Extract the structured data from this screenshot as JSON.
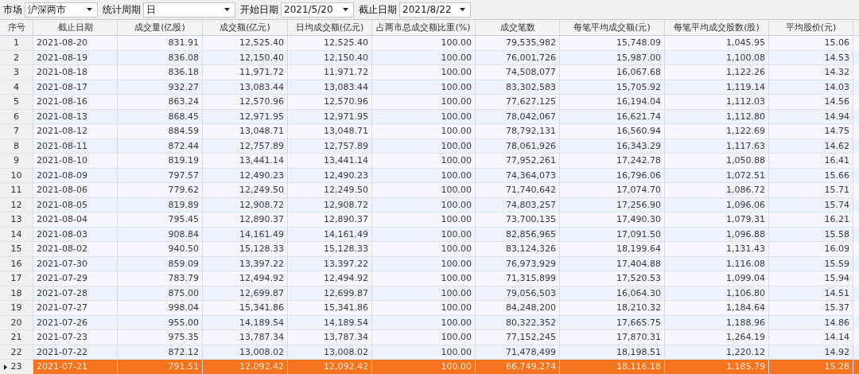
{
  "toolbar": [
    {
      "label": "市场",
      "value": "沪深两市"
    },
    {
      "label": "统计周期",
      "value": "日"
    },
    {
      "label": "开始日期",
      "value": "2021/5/20"
    },
    {
      "label": "截止日期",
      "value": "2021/8/22"
    }
  ],
  "table": {
    "columns": [
      "序号",
      "截止日期",
      "成交量(亿股)",
      "成交额(亿元)",
      "日均成交额(亿元)",
      "占两市总成交额比重(%)",
      "成交笔数",
      "每笔平均成交额(元)",
      "每笔平均成交股数(股)",
      "平均股价(元)"
    ],
    "rows": [
      {
        "selected": false,
        "cells": [
          "1",
          "2021-08-20",
          "831.91",
          "12,525.40",
          "12,525.40",
          "100.00",
          "79,535,982",
          "15,748.09",
          "1,045.95",
          "15.06"
        ]
      },
      {
        "selected": false,
        "cells": [
          "2",
          "2021-08-19",
          "836.08",
          "12,150.40",
          "12,150.40",
          "100.00",
          "76,001,726",
          "15,987.00",
          "1,100.08",
          "14.53"
        ]
      },
      {
        "selected": false,
        "cells": [
          "3",
          "2021-08-18",
          "836.18",
          "11,971.72",
          "11,971.72",
          "100.00",
          "74,508,077",
          "16,067.68",
          "1,122.26",
          "14.32"
        ]
      },
      {
        "selected": false,
        "cells": [
          "4",
          "2021-08-17",
          "932.27",
          "13,083.44",
          "13,083.44",
          "100.00",
          "83,302,583",
          "15,705.92",
          "1,119.14",
          "14.03"
        ]
      },
      {
        "selected": false,
        "cells": [
          "5",
          "2021-08-16",
          "863.24",
          "12,570.96",
          "12,570.96",
          "100.00",
          "77,627,125",
          "16,194.04",
          "1,112.03",
          "14.56"
        ]
      },
      {
        "selected": false,
        "cells": [
          "6",
          "2021-08-13",
          "868.45",
          "12,971.95",
          "12,971.95",
          "100.00",
          "78,042,067",
          "16,621.74",
          "1,112.80",
          "14.94"
        ]
      },
      {
        "selected": false,
        "cells": [
          "7",
          "2021-08-12",
          "884.59",
          "13,048.71",
          "13,048.71",
          "100.00",
          "78,792,131",
          "16,560.94",
          "1,122.69",
          "14.75"
        ]
      },
      {
        "selected": false,
        "cells": [
          "8",
          "2021-08-11",
          "872.44",
          "12,757.89",
          "12,757.89",
          "100.00",
          "78,061,926",
          "16,343.29",
          "1,117.63",
          "14.62"
        ]
      },
      {
        "selected": false,
        "cells": [
          "9",
          "2021-08-10",
          "819.19",
          "13,441.14",
          "13,441.14",
          "100.00",
          "77,952,261",
          "17,242.78",
          "1,050.88",
          "16.41"
        ]
      },
      {
        "selected": false,
        "cells": [
          "10",
          "2021-08-09",
          "797.57",
          "12,490.23",
          "12,490.23",
          "100.00",
          "74,364,073",
          "16,796.06",
          "1,072.51",
          "15.66"
        ]
      },
      {
        "selected": false,
        "cells": [
          "11",
          "2021-08-06",
          "779.62",
          "12,249.50",
          "12,249.50",
          "100.00",
          "71,740,642",
          "17,074.70",
          "1,086.72",
          "15.71"
        ]
      },
      {
        "selected": false,
        "cells": [
          "12",
          "2021-08-05",
          "819.89",
          "12,908.72",
          "12,908.72",
          "100.00",
          "74,803,257",
          "17,256.90",
          "1,096.06",
          "15.74"
        ]
      },
      {
        "selected": false,
        "cells": [
          "13",
          "2021-08-04",
          "795.45",
          "12,890.37",
          "12,890.37",
          "100.00",
          "73,700,135",
          "17,490.30",
          "1,079.31",
          "16.21"
        ]
      },
      {
        "selected": false,
        "cells": [
          "14",
          "2021-08-03",
          "908.84",
          "14,161.49",
          "14,161.49",
          "100.00",
          "82,856,965",
          "17,091.50",
          "1,096.88",
          "15.58"
        ]
      },
      {
        "selected": false,
        "cells": [
          "15",
          "2021-08-02",
          "940.50",
          "15,128.33",
          "15,128.33",
          "100.00",
          "83,124,326",
          "18,199.64",
          "1,131.43",
          "16.09"
        ]
      },
      {
        "selected": false,
        "cells": [
          "16",
          "2021-07-30",
          "859.09",
          "13,397.22",
          "13,397.22",
          "100.00",
          "76,973,929",
          "17,404.88",
          "1,116.08",
          "15.59"
        ]
      },
      {
        "selected": false,
        "cells": [
          "17",
          "2021-07-29",
          "783.79",
          "12,494.92",
          "12,494.92",
          "100.00",
          "71,315,899",
          "17,520.53",
          "1,099.04",
          "15.94"
        ]
      },
      {
        "selected": false,
        "cells": [
          "18",
          "2021-07-28",
          "875.00",
          "12,699.87",
          "12,699.87",
          "100.00",
          "79,056,503",
          "16,064.30",
          "1,106.80",
          "14.51"
        ]
      },
      {
        "selected": false,
        "cells": [
          "19",
          "2021-07-27",
          "998.04",
          "15,341.86",
          "15,341.86",
          "100.00",
          "84,248,200",
          "18,210.32",
          "1,184.64",
          "15.37"
        ]
      },
      {
        "selected": false,
        "cells": [
          "20",
          "2021-07-26",
          "955.00",
          "14,189.54",
          "14,189.54",
          "100.00",
          "80,322,352",
          "17,665.75",
          "1,188.96",
          "14.86"
        ]
      },
      {
        "selected": false,
        "cells": [
          "21",
          "2021-07-23",
          "975.35",
          "13,787.34",
          "13,787.34",
          "100.00",
          "77,152,245",
          "17,870.31",
          "1,264.19",
          "14.14"
        ]
      },
      {
        "selected": false,
        "cells": [
          "22",
          "2021-07-22",
          "872.12",
          "13,008.02",
          "13,008.02",
          "100.00",
          "71,478,499",
          "18,198.51",
          "1,220.12",
          "14.92"
        ]
      },
      {
        "selected": true,
        "cells": [
          "23",
          "2021-07-21",
          "791.51",
          "12,092.42",
          "12,092.42",
          "100.00",
          "66,749,274",
          "18,116.18",
          "1,185.79",
          "15.28"
        ]
      }
    ]
  }
}
